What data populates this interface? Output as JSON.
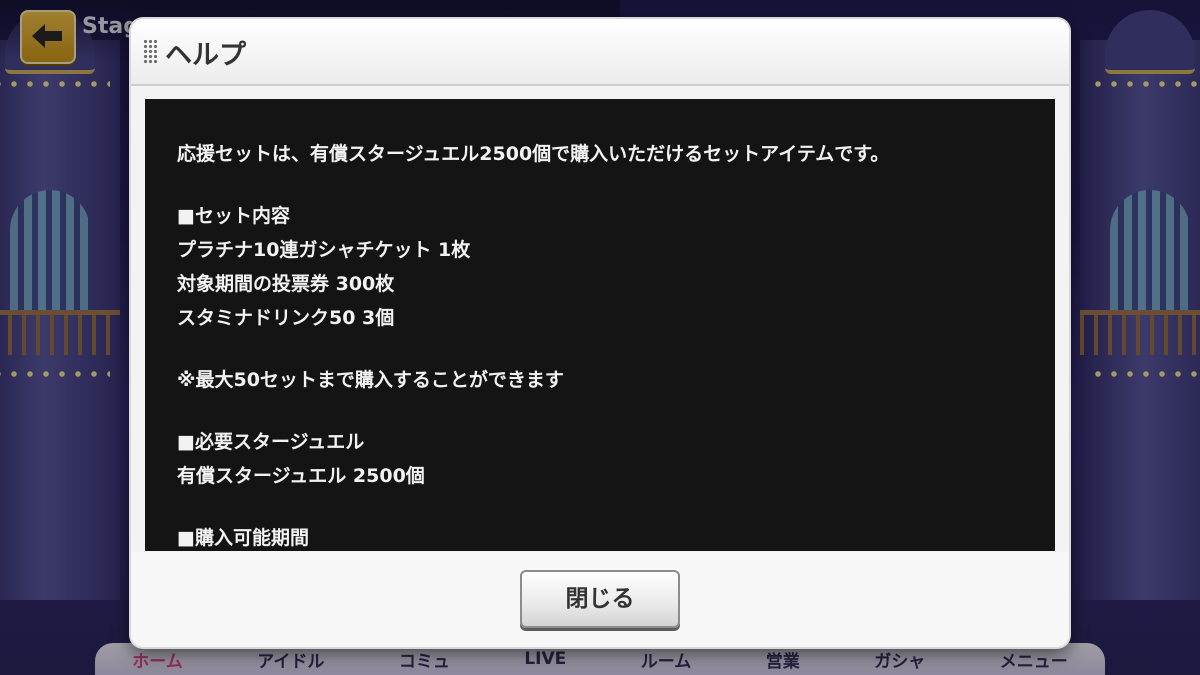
{
  "game": {
    "stage_title": "Stag",
    "back_icon": "arrow-left-icon",
    "nav": [
      "ホーム",
      "アイドル",
      "コミュ",
      "LIVE",
      "ルーム",
      "営業",
      "ガシャ",
      "メニュー"
    ]
  },
  "dialog": {
    "title": "ヘルプ",
    "title_icon": "grip-icon",
    "lines": [
      "応援セットは、有償スタージュエル2500個で購入いただけるセットアイテムです。",
      "",
      "■セット内容",
      "プラチナ10連ガシャチケット 1枚",
      "対象期間の投票券 300枚",
      "スタミナドリンク50 3個",
      "",
      "※最大50セットまで購入することができます",
      "",
      "■必要スタージュエル",
      "有償スタージュエル 2500個",
      "",
      "■購入可能期間"
    ],
    "close_label": "閉じる"
  },
  "colors": {
    "dialog_body": "#141414",
    "dialog_frame": "#f3f3f3",
    "accent_back": "#f4c64a"
  }
}
